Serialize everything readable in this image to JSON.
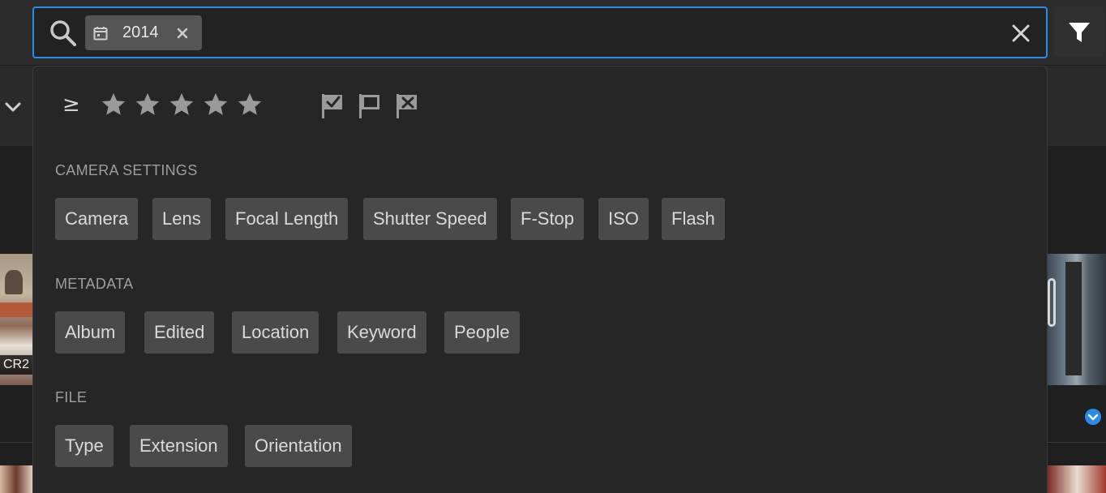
{
  "search": {
    "token_label": "2014",
    "accent_color": "#2b8ce8"
  },
  "rating": {
    "operator": "≥",
    "star_count": 5,
    "flags": [
      "flag-picked-icon",
      "flag-unflagged-icon",
      "flag-rejected-icon"
    ]
  },
  "sections": [
    {
      "label": "CAMERA SETTINGS",
      "chips": [
        "Camera",
        "Lens",
        "Focal Length",
        "Shutter Speed",
        "F-Stop",
        "ISO",
        "Flash"
      ]
    },
    {
      "label": "METADATA",
      "chips": [
        "Album",
        "Edited",
        "Location",
        "Keyword",
        "People"
      ]
    },
    {
      "label": "FILE",
      "chips": [
        "Type",
        "Extension",
        "Orientation"
      ]
    }
  ],
  "background": {
    "file_badge": "CR2"
  }
}
